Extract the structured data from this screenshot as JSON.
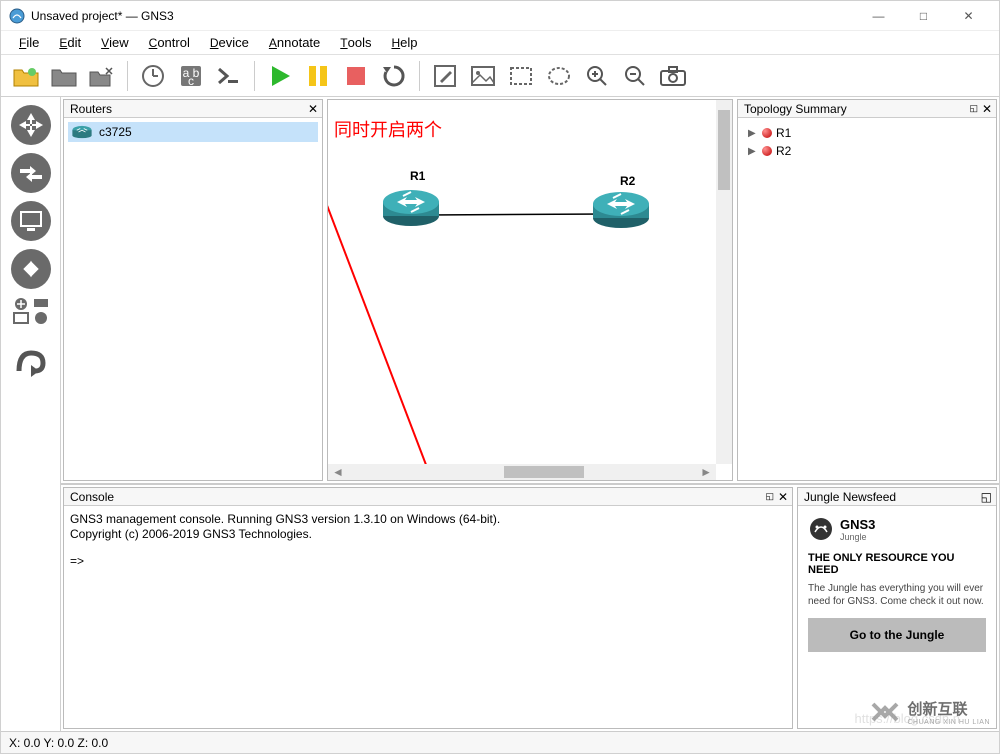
{
  "window": {
    "title": "Unsaved project* — GNS3",
    "minimize": "—",
    "maximize": "□",
    "close": "✕"
  },
  "menu": {
    "file": "File",
    "edit": "Edit",
    "view": "View",
    "control": "Control",
    "device": "Device",
    "annotate": "Annotate",
    "tools": "Tools",
    "help": "Help"
  },
  "panels": {
    "routers_title": "Routers",
    "topology_title": "Topology Summary",
    "console_title": "Console",
    "newsfeed_title": "Jungle Newsfeed"
  },
  "routers_list": {
    "item1": "c3725"
  },
  "topology": {
    "r1": "R1",
    "r2": "R2"
  },
  "canvas": {
    "node1_label": "R1",
    "node2_label": "R2",
    "annotation_text": "同时开启两个"
  },
  "console": {
    "line1": "GNS3 management console. Running GNS3 version 1.3.10 on Windows (64-bit).",
    "line2": "Copyright (c) 2006-2019 GNS3 Technologies.",
    "prompt": "=>"
  },
  "newsfeed": {
    "brand_top": "GNS3",
    "brand_bottom": "Jungle",
    "heading": "THE ONLY RESOURCE YOU NEED",
    "body": "The Jungle has everything you will ever need for GNS3. Come check it out now.",
    "button": "Go to the Jungle"
  },
  "status": {
    "coords": "X: 0.0 Y: 0.0 Z: 0.0"
  },
  "watermark": {
    "cn": "创新互联",
    "en": "CHUANG XIN HU LIAN",
    "url": "https://blog.csdn.n"
  }
}
